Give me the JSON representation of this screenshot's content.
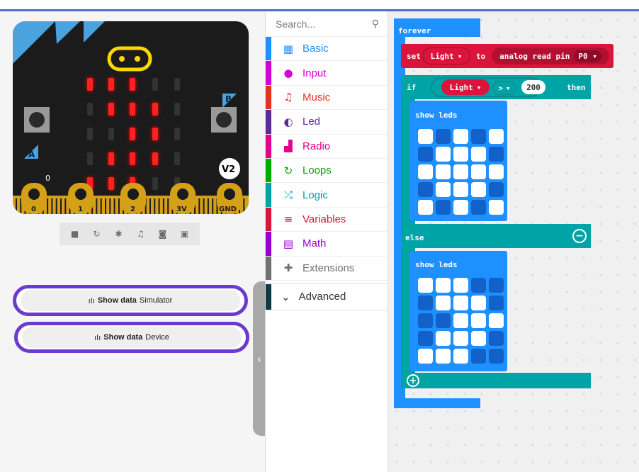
{
  "simulator": {
    "pin_labels": [
      "0",
      "1",
      "2",
      "3V",
      "GND"
    ],
    "version_badge": "V2",
    "button_a": "A",
    "button_b": "B",
    "board_zero": "0",
    "led_matrix": [
      [
        1,
        1,
        1,
        0,
        0
      ],
      [
        0,
        1,
        1,
        1,
        0
      ],
      [
        0,
        0,
        1,
        1,
        0
      ],
      [
        0,
        1,
        1,
        1,
        0
      ],
      [
        1,
        1,
        1,
        0,
        0
      ]
    ],
    "controls": [
      "stop-icon",
      "restart-icon",
      "debug-icon",
      "sound-icon",
      "screenshot-icon",
      "fullscreen-icon"
    ],
    "show_data_simulator": {
      "bold": "Show data",
      "normal": "Simulator"
    },
    "show_data_device": {
      "bold": "Show data",
      "normal": "Device"
    }
  },
  "toolbox": {
    "search_placeholder": "Search...",
    "categories": [
      {
        "label": "Basic",
        "color": "#1e90ff",
        "icon": "grid-icon"
      },
      {
        "label": "Input",
        "color": "#d400d4",
        "icon": "circle-icon"
      },
      {
        "label": "Music",
        "color": "#e63022",
        "icon": "headphones-icon"
      },
      {
        "label": "Led",
        "color": "#5c2d91",
        "icon": "toggle-icon"
      },
      {
        "label": "Radio",
        "color": "#e3008c",
        "icon": "signal-icon"
      },
      {
        "label": "Loops",
        "color": "#00aa00",
        "icon": "loop-icon"
      },
      {
        "label": "Logic",
        "color": "#00a4a6",
        "icon": "shuffle-icon"
      },
      {
        "label": "Variables",
        "color": "#dc143c",
        "icon": "list-icon"
      },
      {
        "label": "Math",
        "color": "#9400d3",
        "icon": "calculator-icon"
      },
      {
        "label": "Extensions",
        "color": "#707070",
        "icon": "plus-icon"
      }
    ],
    "advanced": "Advanced"
  },
  "blocks": {
    "forever": "forever",
    "set": "set",
    "variable": "Light",
    "to": "to",
    "analog_read": "analog read pin",
    "pin": "P0",
    "if": "if",
    "compare_var": "Light",
    "operator": ">",
    "threshold": "200",
    "then": "then",
    "show_leds_1": "show leds",
    "else": "else",
    "show_leds_2": "show leds",
    "leds_1": [
      [
        1,
        0,
        1,
        0,
        1
      ],
      [
        0,
        1,
        1,
        1,
        0
      ],
      [
        1,
        1,
        1,
        1,
        1
      ],
      [
        0,
        1,
        1,
        1,
        0
      ],
      [
        1,
        0,
        1,
        0,
        1
      ]
    ],
    "leds_2": [
      [
        1,
        1,
        1,
        0,
        0
      ],
      [
        0,
        1,
        1,
        1,
        0
      ],
      [
        0,
        0,
        1,
        1,
        1
      ],
      [
        0,
        1,
        1,
        1,
        0
      ],
      [
        1,
        1,
        1,
        0,
        0
      ]
    ]
  },
  "colors": {
    "forever_blue": "#1e90ff",
    "variables_red": "#dc143c",
    "logic_teal": "#00a4a6",
    "basic_blue": "#1e90ff",
    "led_on": "#ff0000",
    "pin_gold": "#d4a017",
    "show_data_border": "#6a3bcd"
  }
}
